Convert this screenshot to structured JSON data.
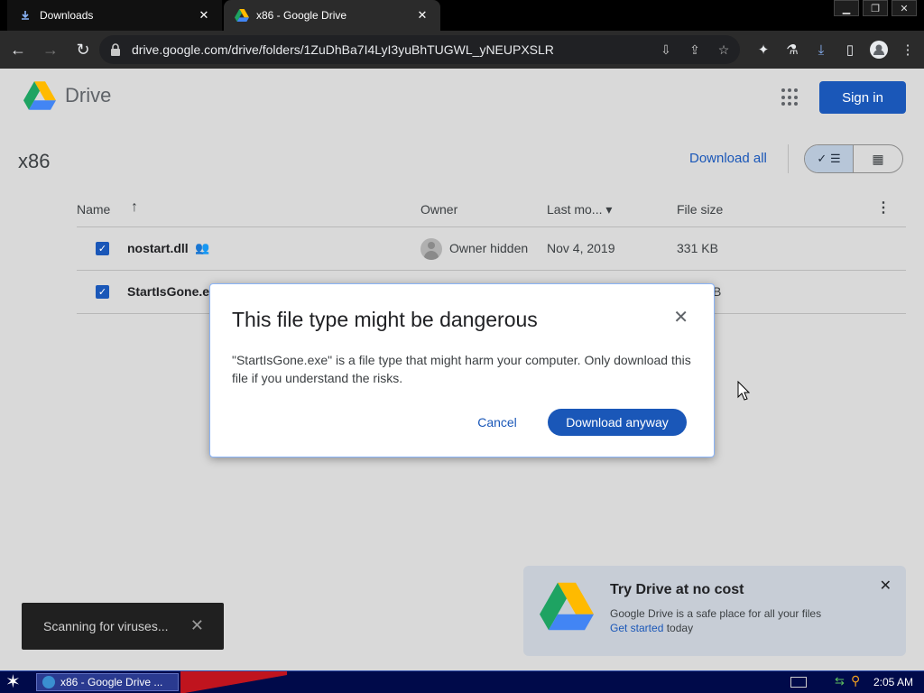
{
  "browser": {
    "tabs": [
      {
        "label": "Downloads",
        "icon": "download-icon",
        "active": false
      },
      {
        "label": "x86 - Google Drive",
        "icon": "drive-logo-icon",
        "active": true
      }
    ],
    "window_controls": [
      "minimize",
      "restore",
      "close"
    ],
    "url": "drive.google.com/drive/folders/1ZuDhBa7I4LyI3yuBhTUGWL_yNEUPXSLR"
  },
  "header": {
    "product_name": "Drive",
    "signin_label": "Sign in"
  },
  "folder": {
    "title": "x86",
    "download_all_label": "Download all"
  },
  "table": {
    "columns": {
      "name": "Name",
      "owner": "Owner",
      "modified": "Last mo...",
      "size": "File size"
    },
    "rows": [
      {
        "name": "nostart.dll",
        "owner": "Owner hidden",
        "modified": "Nov 4, 2019",
        "size": "331 KB",
        "shared": true,
        "checked": true
      },
      {
        "name": "StartIsGone.e",
        "owner": "",
        "modified": "",
        "size": "B",
        "shared": false,
        "checked": true
      }
    ]
  },
  "dialog": {
    "title": "This file type might be dangerous",
    "message": "\"StartIsGone.exe\" is a file type that might harm your computer. Only download this file if you understand the risks.",
    "cancel_label": "Cancel",
    "confirm_label": "Download anyway"
  },
  "toast": {
    "message": "Scanning for viruses..."
  },
  "promo": {
    "title": "Try Drive at no cost",
    "body": "Google Drive is a safe place for all your files",
    "link_label": "Get started",
    "link_suffix": " today"
  },
  "taskbar": {
    "task_label": "x86 - Google Drive ...",
    "clock": "2:05 AM"
  },
  "colors": {
    "accent": "#1a57b8",
    "drive_green": "#1ea362",
    "drive_yellow": "#ffba00",
    "drive_blue": "#4285f4"
  }
}
